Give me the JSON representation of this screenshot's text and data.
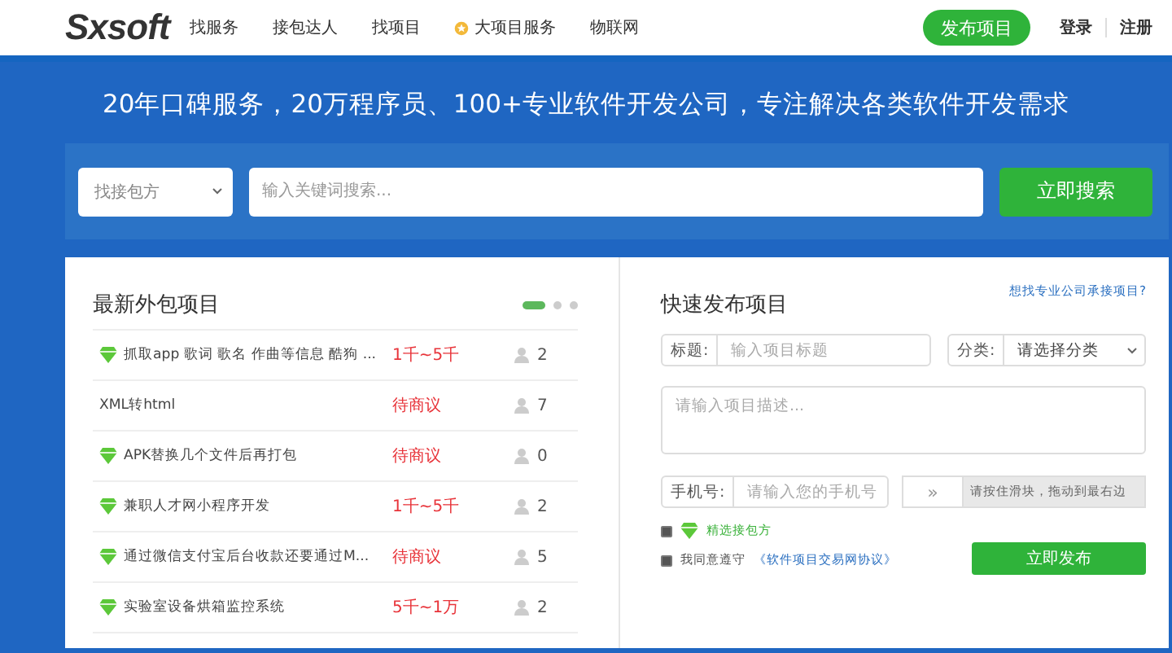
{
  "header": {
    "logo": "Sxsoft",
    "nav": [
      {
        "label": "找服务",
        "icon": false
      },
      {
        "label": "接包达人",
        "icon": false
      },
      {
        "label": "找项目",
        "icon": false
      },
      {
        "label": "大项目服务",
        "icon": true
      },
      {
        "label": "物联网",
        "icon": false
      }
    ],
    "publish_button": "发布项目",
    "login": "登录",
    "register": "注册"
  },
  "hero": {
    "tagline": "20年口碑服务，20万程序员、100+专业软件开发公司，专注解决各类软件开发需求"
  },
  "search": {
    "scope": "找接包方",
    "placeholder": "输入关键词搜索...",
    "button": "立即搜索"
  },
  "projects": {
    "title": "最新外包项目",
    "pages": [
      {
        "selected": true
      },
      {
        "selected": false
      },
      {
        "selected": false
      }
    ],
    "rows": [
      {
        "name": "抓取app 歌词 歌名 作曲等信息 酷狗 ...",
        "featured": true,
        "budget": "1千~5千",
        "bids": "2"
      },
      {
        "name": "XML转html",
        "featured": false,
        "budget": "待商议",
        "bids": "7"
      },
      {
        "name": "APK替换几个文件后再打包",
        "featured": true,
        "budget": "待商议",
        "bids": "0"
      },
      {
        "name": "兼职人才网小程序开发",
        "featured": true,
        "budget": "1千~5千",
        "bids": "2"
      },
      {
        "name": "通过微信支付宝后台收款还要通过M...",
        "featured": true,
        "budget": "待商议",
        "bids": "5"
      },
      {
        "name": "实验室设备烘箱监控系统",
        "featured": true,
        "budget": "5千~1万",
        "bids": "2"
      }
    ]
  },
  "quick_publish": {
    "title": "快速发布项目",
    "link": "想找专业公司承接项目?",
    "title_label": "标题:",
    "title_placeholder": "输入项目标题",
    "category_label": "分类:",
    "category_value": "请选择分类",
    "description_placeholder": "请输入项目描述...",
    "phone_label": "手机号:",
    "phone_placeholder": "请输入您的手机号",
    "slider_arrow": "»",
    "slider_hint": "请按住滑块，拖动到最右边",
    "options": [
      {
        "label": "精选接包方",
        "checked": true,
        "kind": "badge"
      },
      {
        "label": "我同意遵守",
        "link": "《软件项目交易网协议》",
        "checked": true,
        "kind": "agreement"
      }
    ],
    "submit": "立即发布"
  }
}
